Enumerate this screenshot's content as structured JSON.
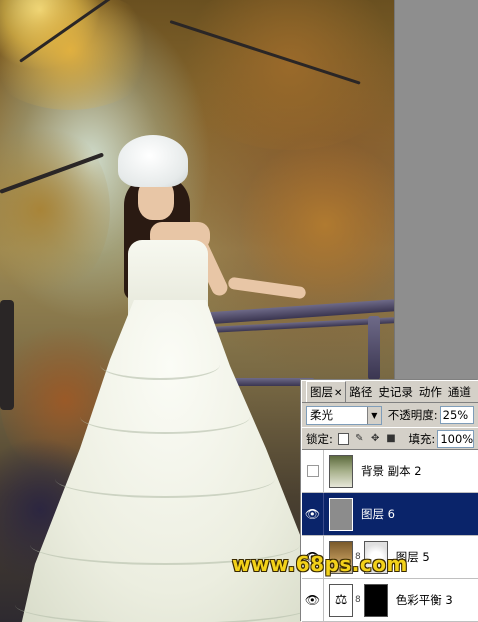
{
  "panel": {
    "tabs": [
      {
        "label": "图层",
        "active": true,
        "closable": true
      },
      {
        "label": "路径",
        "active": false
      },
      {
        "label": "史记录",
        "active": false
      },
      {
        "label": "动作",
        "active": false
      },
      {
        "label": "通道",
        "active": false
      }
    ],
    "blend_mode": "柔光",
    "opacity_label": "不透明度:",
    "opacity_value": "25%",
    "lock_label": "锁定:",
    "fill_label": "填充:",
    "fill_value": "100%",
    "layers": [
      {
        "name": "背景 副本 2",
        "visible": false,
        "selected": false,
        "thumb": "photo",
        "mask": null
      },
      {
        "name": "图层 6",
        "visible": true,
        "selected": true,
        "thumb": "gray",
        "mask": null
      },
      {
        "name": "图层 5",
        "visible": true,
        "selected": false,
        "thumb": "photo2",
        "mask": "white-blob"
      },
      {
        "name": "色彩平衡 3",
        "visible": true,
        "selected": false,
        "thumb": "adjustment",
        "mask": "black"
      }
    ]
  },
  "watermark": "www.68ps.com",
  "colors": {
    "selection": "#0a246a",
    "panel_bg": "#d4d0c8",
    "watermark": "#f3d21a"
  }
}
